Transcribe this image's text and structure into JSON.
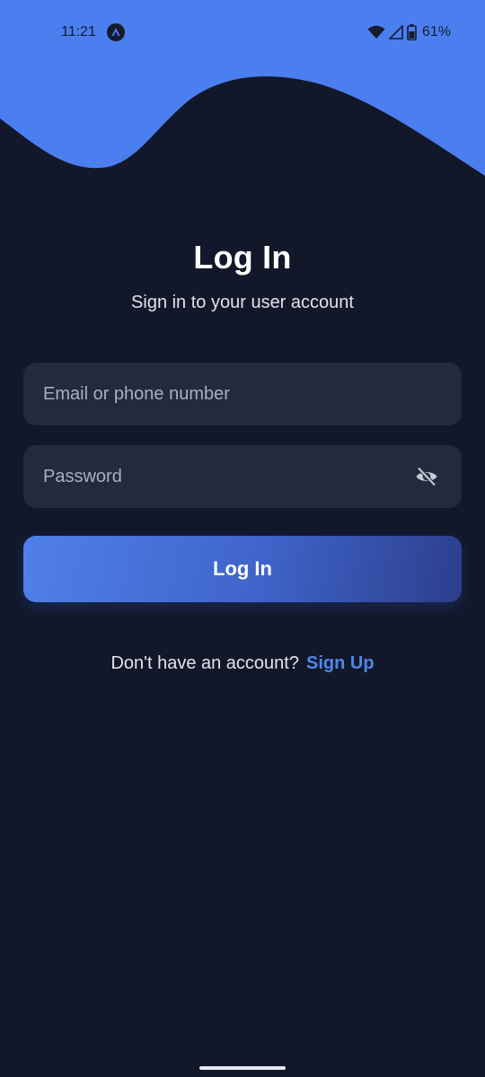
{
  "status_bar": {
    "time": "11:21",
    "battery_percent": "61%",
    "icons": [
      "app-notification-icon",
      "wifi-icon",
      "signal-icon",
      "battery-icon"
    ]
  },
  "login": {
    "title": "Log In",
    "subtitle": "Sign in to your user account",
    "email_placeholder": "Email or phone number",
    "email_value": "",
    "password_placeholder": "Password",
    "password_value": "",
    "password_toggle_icon": "eye-off-icon",
    "button_label": "Log In"
  },
  "signup": {
    "prompt": "Don't have an account?",
    "link_label": "Sign Up"
  },
  "colors": {
    "background": "#121829",
    "accent": "#4b7ff0",
    "field_background": "#222a3c",
    "link": "#4f86ef"
  }
}
